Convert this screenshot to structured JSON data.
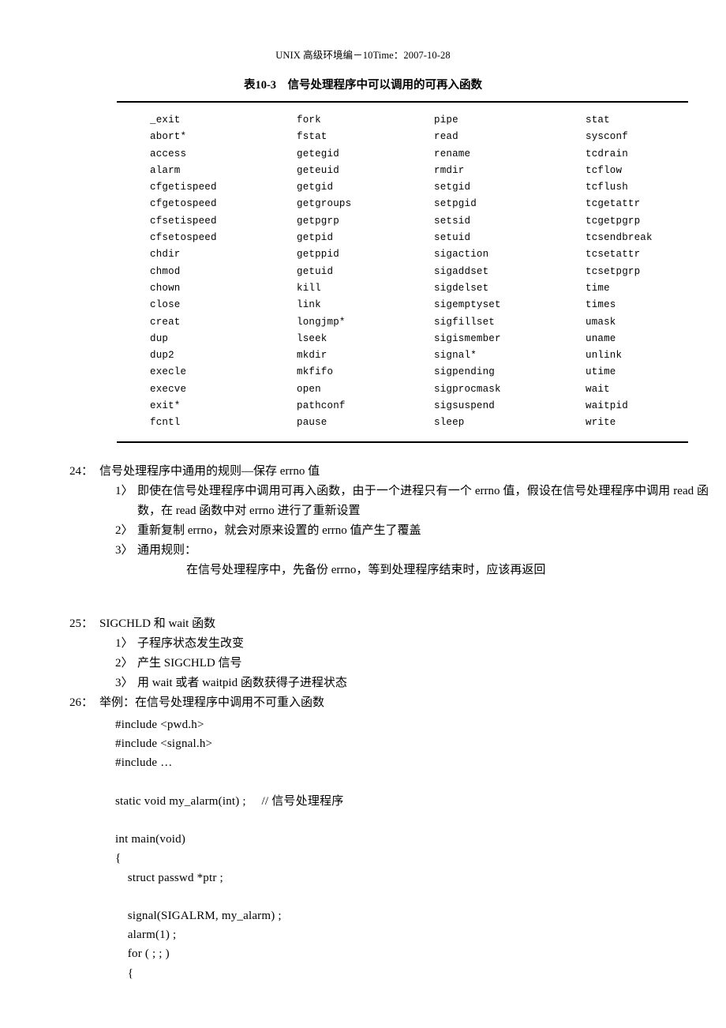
{
  "header": {
    "running_head": "UNIX 高级环境编－10Time：2007-10-28"
  },
  "table": {
    "caption": "表10-3　信号处理程序中可以调用的可再入函数",
    "columns": [
      [
        "_exit",
        "abort*",
        "access",
        "alarm",
        "cfgetispeed",
        "cfgetospeed",
        "cfsetispeed",
        "cfsetospeed",
        "chdir",
        "chmod",
        "chown",
        "close",
        "creat",
        "dup",
        "dup2",
        "execle",
        "execve",
        "exit*",
        "fcntl"
      ],
      [
        "fork",
        "fstat",
        "getegid",
        "geteuid",
        "getgid",
        "getgroups",
        "getpgrp",
        "getpid",
        "getppid",
        "getuid",
        "kill",
        "link",
        "longjmp*",
        "lseek",
        "mkdir",
        "mkfifo",
        "open",
        "pathconf",
        "pause"
      ],
      [
        "pipe",
        "read",
        "rename",
        "rmdir",
        "setgid",
        "setpgid",
        "setsid",
        "setuid",
        "sigaction",
        "sigaddset",
        "sigdelset",
        "sigemptyset",
        "sigfillset",
        "sigismember",
        "signal*",
        "sigpending",
        "sigprocmask",
        "sigsuspend",
        "sleep"
      ],
      [
        "stat",
        "sysconf",
        "tcdrain",
        "tcflow",
        "tcflush",
        "tcgetattr",
        "tcgetpgrp",
        "tcsendbreak",
        "tcsetattr",
        "tcsetpgrp",
        "time",
        "times",
        "umask",
        "uname",
        "unlink",
        "utime",
        "wait",
        "waitpid",
        "write"
      ]
    ]
  },
  "sections": {
    "s24": {
      "num": "24：",
      "title": "信号处理程序中通用的规则—保存 errno 值",
      "items": [
        {
          "num": "1〉",
          "text": "即使在信号处理程序中调用可再入函数，由于一个进程只有一个 errno 值，假设在信号处理程序中调用 read 函数，在 read 函数中对 errno 进行了重新设置"
        },
        {
          "num": "2〉",
          "text": "重新复制 errno，就会对原来设置的 errno 值产生了覆盖"
        },
        {
          "num": "3〉",
          "text": "通用规则："
        }
      ],
      "rule_detail": "在信号处理程序中，先备份 errno，等到处理程序结束时，应该再返回"
    },
    "s25": {
      "num": "25：",
      "title": "SIGCHLD 和 wait 函数",
      "items": [
        {
          "num": "1〉",
          "text": "子程序状态发生改变"
        },
        {
          "num": "2〉",
          "text": "产生 SIGCHLD 信号"
        },
        {
          "num": "3〉",
          "text": "用 wait 或者 waitpid 函数获得子进程状态"
        }
      ]
    },
    "s26": {
      "num": "26：",
      "title": "举例：在信号处理程序中调用不可重入函数"
    }
  },
  "code": {
    "lines": [
      "#include <pwd.h>",
      "#include <signal.h>",
      "#include …",
      "",
      "static void my_alarm(int) ;     // 信号处理程序",
      "",
      "int main(void)",
      "{",
      "    struct passwd *ptr ;",
      "",
      "    signal(SIGALRM, my_alarm) ;",
      "    alarm(1) ;",
      "    for ( ; ; )",
      "    {"
    ]
  }
}
